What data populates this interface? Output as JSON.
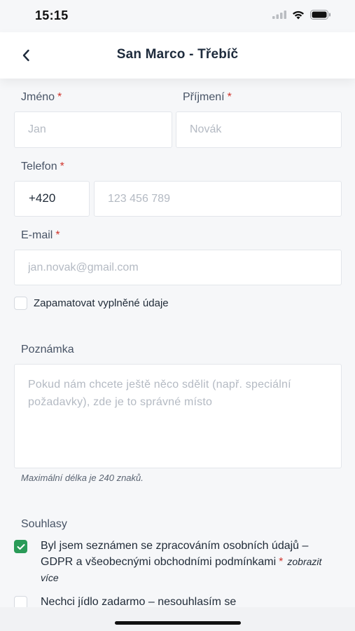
{
  "status": {
    "time": "15:15"
  },
  "header": {
    "title": "San Marco - Třebíč"
  },
  "form": {
    "first_name": {
      "label": "Jméno",
      "required": "*",
      "placeholder": "Jan"
    },
    "last_name": {
      "label": "Příjmení",
      "required": "*",
      "placeholder": "Novák"
    },
    "phone": {
      "label": "Telefon",
      "required": "*",
      "prefix": "+420",
      "placeholder": "123 456 789"
    },
    "email": {
      "label": "E-mail",
      "required": "*",
      "placeholder": "jan.novak@gmail.com"
    },
    "remember": {
      "label": "Zapamatovat vyplněné údaje",
      "checked": false
    },
    "note": {
      "label": "Poznámka",
      "placeholder": "Pokud nám chcete ještě něco sdělit (např. speciální požadavky), zde je to správné místo",
      "hint": "Maximální délka je 240 znaků."
    }
  },
  "consents": {
    "title": "Souhlasy",
    "items": [
      {
        "text": "Byl jsem seznámen se zpracováním osobních údajů – GDPR a všeobecnými obchodními podmínkami",
        "required": "*",
        "more": "zobrazit více",
        "checked": true
      },
      {
        "text": "Nechci jídlo zadarmo – nesouhlasím se",
        "checked": false
      }
    ]
  },
  "colors": {
    "required": "#d0342c",
    "checked": "#2a9b58",
    "background": "#f6f7f9"
  },
  "icons": [
    "back-chevron-icon",
    "signal-icon",
    "wifi-icon",
    "battery-icon",
    "checkmark-icon"
  ]
}
